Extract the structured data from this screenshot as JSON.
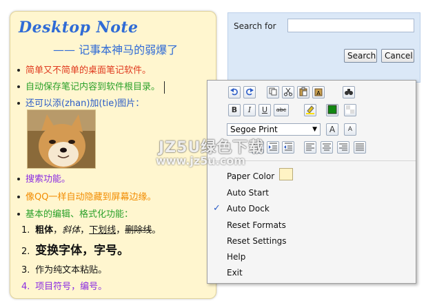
{
  "note": {
    "title": "Desktop Note",
    "subtitle": "—— 记事本神马的弱爆了",
    "items": [
      {
        "text": "简单又不简单的桌面笔记软件。"
      },
      {
        "text": "自动保存笔记内容到软件根目录。"
      },
      {
        "text": "还可以添(zhan)加(tie)图片："
      },
      {
        "text": "搜索功能。"
      },
      {
        "text": "像QQ一样自动隐藏到屏幕边缘。"
      },
      {
        "text": "基本的编辑、格式化功能："
      }
    ],
    "sub_items": {
      "n1": "1.",
      "bold": "粗体",
      "comma1": "，",
      "italic": "斜体",
      "comma2": "，",
      "underline": "下划线",
      "comma3": "，",
      "strike": "删除线",
      "end1": "。",
      "n2": "2.",
      "change_font": "变换字体，字号。",
      "n3": "3.",
      "paste": "作为纯文本粘贴。",
      "n4": "4.",
      "numbering": "项目符号，编号。"
    },
    "image_icon": "shiba-dog-photo"
  },
  "watermark": {
    "text": "JZ5U绿色下载",
    "url": "www.jz5u.com"
  },
  "search": {
    "label": "Search for",
    "value": "",
    "search_button": "Search",
    "cancel_button": "Cancel"
  },
  "menu": {
    "font_name": "Segoe Print",
    "toolbar": {
      "bold": "B",
      "italic": "I",
      "underline": "U",
      "strike": "abc",
      "grow": "A",
      "shrink": "A"
    },
    "items": [
      {
        "label": "Paper Color"
      },
      {
        "label": "Auto Start"
      },
      {
        "label": "Auto Dock",
        "checked": true
      },
      {
        "label": "Reset Formats"
      },
      {
        "label": "Reset Settings"
      },
      {
        "label": "Help"
      },
      {
        "label": "Exit"
      }
    ],
    "check_mark": "✓",
    "colors": {
      "paper": "#fff3c4",
      "text": "#118811"
    }
  }
}
